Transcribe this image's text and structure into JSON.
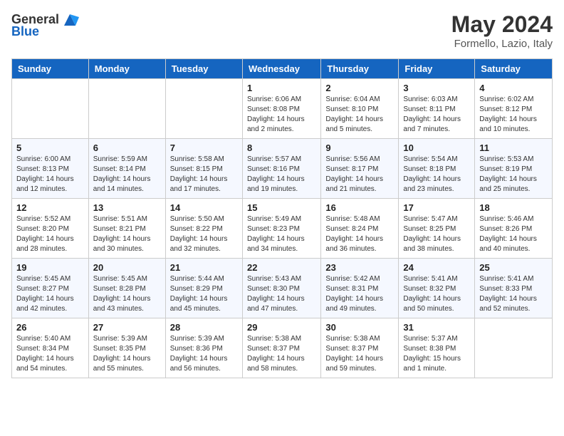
{
  "header": {
    "logo_general": "General",
    "logo_blue": "Blue",
    "month_year": "May 2024",
    "location": "Formello, Lazio, Italy"
  },
  "days_of_week": [
    "Sunday",
    "Monday",
    "Tuesday",
    "Wednesday",
    "Thursday",
    "Friday",
    "Saturday"
  ],
  "weeks": [
    [
      {
        "day": "",
        "info": ""
      },
      {
        "day": "",
        "info": ""
      },
      {
        "day": "",
        "info": ""
      },
      {
        "day": "1",
        "info": "Sunrise: 6:06 AM\nSunset: 8:08 PM\nDaylight: 14 hours\nand 2 minutes."
      },
      {
        "day": "2",
        "info": "Sunrise: 6:04 AM\nSunset: 8:10 PM\nDaylight: 14 hours\nand 5 minutes."
      },
      {
        "day": "3",
        "info": "Sunrise: 6:03 AM\nSunset: 8:11 PM\nDaylight: 14 hours\nand 7 minutes."
      },
      {
        "day": "4",
        "info": "Sunrise: 6:02 AM\nSunset: 8:12 PM\nDaylight: 14 hours\nand 10 minutes."
      }
    ],
    [
      {
        "day": "5",
        "info": "Sunrise: 6:00 AM\nSunset: 8:13 PM\nDaylight: 14 hours\nand 12 minutes."
      },
      {
        "day": "6",
        "info": "Sunrise: 5:59 AM\nSunset: 8:14 PM\nDaylight: 14 hours\nand 14 minutes."
      },
      {
        "day": "7",
        "info": "Sunrise: 5:58 AM\nSunset: 8:15 PM\nDaylight: 14 hours\nand 17 minutes."
      },
      {
        "day": "8",
        "info": "Sunrise: 5:57 AM\nSunset: 8:16 PM\nDaylight: 14 hours\nand 19 minutes."
      },
      {
        "day": "9",
        "info": "Sunrise: 5:56 AM\nSunset: 8:17 PM\nDaylight: 14 hours\nand 21 minutes."
      },
      {
        "day": "10",
        "info": "Sunrise: 5:54 AM\nSunset: 8:18 PM\nDaylight: 14 hours\nand 23 minutes."
      },
      {
        "day": "11",
        "info": "Sunrise: 5:53 AM\nSunset: 8:19 PM\nDaylight: 14 hours\nand 25 minutes."
      }
    ],
    [
      {
        "day": "12",
        "info": "Sunrise: 5:52 AM\nSunset: 8:20 PM\nDaylight: 14 hours\nand 28 minutes."
      },
      {
        "day": "13",
        "info": "Sunrise: 5:51 AM\nSunset: 8:21 PM\nDaylight: 14 hours\nand 30 minutes."
      },
      {
        "day": "14",
        "info": "Sunrise: 5:50 AM\nSunset: 8:22 PM\nDaylight: 14 hours\nand 32 minutes."
      },
      {
        "day": "15",
        "info": "Sunrise: 5:49 AM\nSunset: 8:23 PM\nDaylight: 14 hours\nand 34 minutes."
      },
      {
        "day": "16",
        "info": "Sunrise: 5:48 AM\nSunset: 8:24 PM\nDaylight: 14 hours\nand 36 minutes."
      },
      {
        "day": "17",
        "info": "Sunrise: 5:47 AM\nSunset: 8:25 PM\nDaylight: 14 hours\nand 38 minutes."
      },
      {
        "day": "18",
        "info": "Sunrise: 5:46 AM\nSunset: 8:26 PM\nDaylight: 14 hours\nand 40 minutes."
      }
    ],
    [
      {
        "day": "19",
        "info": "Sunrise: 5:45 AM\nSunset: 8:27 PM\nDaylight: 14 hours\nand 42 minutes."
      },
      {
        "day": "20",
        "info": "Sunrise: 5:45 AM\nSunset: 8:28 PM\nDaylight: 14 hours\nand 43 minutes."
      },
      {
        "day": "21",
        "info": "Sunrise: 5:44 AM\nSunset: 8:29 PM\nDaylight: 14 hours\nand 45 minutes."
      },
      {
        "day": "22",
        "info": "Sunrise: 5:43 AM\nSunset: 8:30 PM\nDaylight: 14 hours\nand 47 minutes."
      },
      {
        "day": "23",
        "info": "Sunrise: 5:42 AM\nSunset: 8:31 PM\nDaylight: 14 hours\nand 49 minutes."
      },
      {
        "day": "24",
        "info": "Sunrise: 5:41 AM\nSunset: 8:32 PM\nDaylight: 14 hours\nand 50 minutes."
      },
      {
        "day": "25",
        "info": "Sunrise: 5:41 AM\nSunset: 8:33 PM\nDaylight: 14 hours\nand 52 minutes."
      }
    ],
    [
      {
        "day": "26",
        "info": "Sunrise: 5:40 AM\nSunset: 8:34 PM\nDaylight: 14 hours\nand 54 minutes."
      },
      {
        "day": "27",
        "info": "Sunrise: 5:39 AM\nSunset: 8:35 PM\nDaylight: 14 hours\nand 55 minutes."
      },
      {
        "day": "28",
        "info": "Sunrise: 5:39 AM\nSunset: 8:36 PM\nDaylight: 14 hours\nand 56 minutes."
      },
      {
        "day": "29",
        "info": "Sunrise: 5:38 AM\nSunset: 8:37 PM\nDaylight: 14 hours\nand 58 minutes."
      },
      {
        "day": "30",
        "info": "Sunrise: 5:38 AM\nSunset: 8:37 PM\nDaylight: 14 hours\nand 59 minutes."
      },
      {
        "day": "31",
        "info": "Sunrise: 5:37 AM\nSunset: 8:38 PM\nDaylight: 15 hours\nand 1 minute."
      },
      {
        "day": "",
        "info": ""
      }
    ]
  ]
}
